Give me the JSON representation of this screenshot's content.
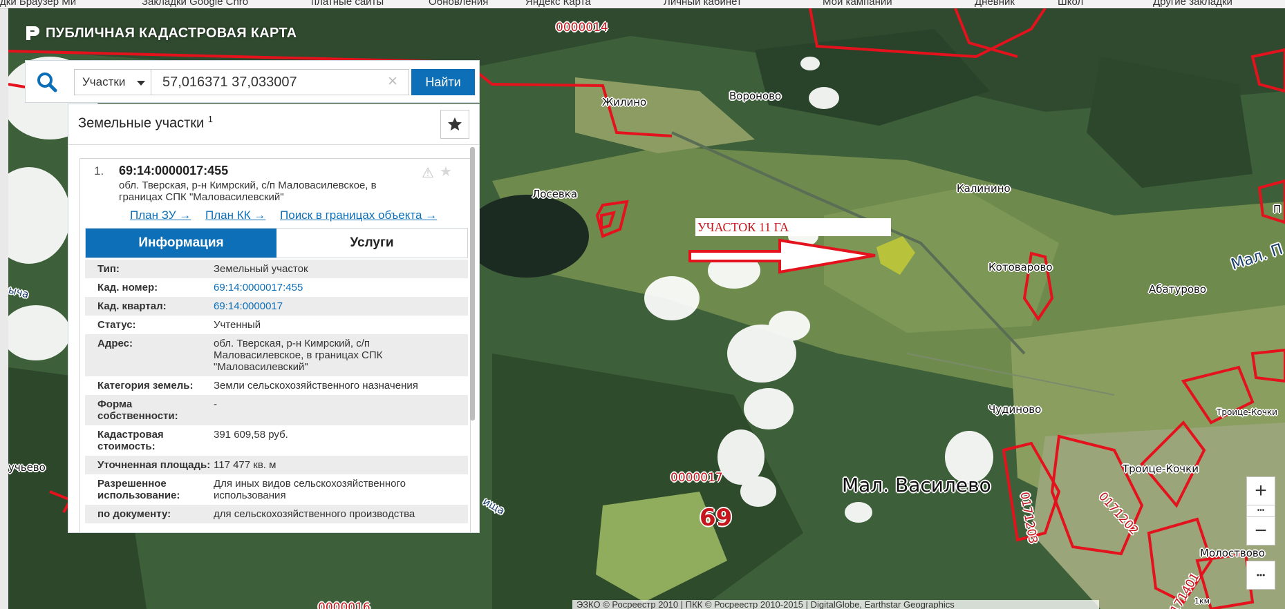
{
  "bookmarks": [
    {
      "label": "дки Браузер Ми"
    },
    {
      "label": "Закладки Google Chro"
    },
    {
      "label": "платные сайты"
    },
    {
      "label": "Обновления"
    },
    {
      "label": "Яндекс Карта"
    },
    {
      "label": "Личный кабинет"
    },
    {
      "label": "Мои кампании"
    },
    {
      "label": "Дневник"
    },
    {
      "label": "Школ"
    },
    {
      "label": "Другие закладки"
    }
  ],
  "header": {
    "title": "ПУБЛИЧНАЯ КАДАСТРОВАЯ КАРТА"
  },
  "search": {
    "type_label": "Участки",
    "query": "57,016371 37,033007",
    "clear_symbol": "×",
    "find_label": "Найти"
  },
  "results_panel": {
    "title": "Земельные участки",
    "count": "1",
    "item": {
      "number": "1.",
      "cad_number": "69:14:0000017:455",
      "address": "обл. Тверская, р-н Кимрский, с/п Маловасилевское, в границах СПК \"Маловасилевский\"",
      "links": [
        "План ЗУ →",
        "План КК →",
        "Поиск в границах объекта →"
      ],
      "tabs": [
        "Информация",
        "Услуги"
      ],
      "attributes": [
        {
          "key": "Тип:",
          "value": "Земельный участок"
        },
        {
          "key": "Кад. номер:",
          "value": "69:14:0000017:455"
        },
        {
          "key": "Кад. квартал:",
          "value": "69:14:0000017"
        },
        {
          "key": "Статус:",
          "value": "Учтенный"
        },
        {
          "key": "Адрес:",
          "value": "обл. Тверская, р-н Кимрский, с/п Маловасилевское, в границах СПК \"Маловасилевский\""
        },
        {
          "key": "Категория земель:",
          "value": "Земли сельскохозяйственного назначения"
        },
        {
          "key": "Форма собственности:",
          "value": "-"
        },
        {
          "key": "Кадастровая стоимость:",
          "value": "391 609,58 руб."
        },
        {
          "key": "Уточненная площадь:",
          "value": "117 477 кв. м"
        },
        {
          "key": "Разрешенное использование:",
          "value": "Для иных видов сельскохозяйственного использования"
        },
        {
          "key": "по документу:",
          "value": "для сельскохозяйственного производства"
        }
      ]
    }
  },
  "map": {
    "annotation": "УЧАСТОК 11 ГА",
    "places": [
      "Жилино",
      "Вороново",
      "Лосевка",
      "Калинино",
      "Котоварово",
      "Абатурово",
      "Чудиново",
      "Мал. Василево",
      "Троице-Кочки",
      "Молоствово",
      "Троице-Кочки",
      "учьево",
      "Мал. П",
      "П",
      "ыча",
      "ища"
    ],
    "quarters": [
      "0000014",
      "0000017",
      "0171203",
      "0171202",
      "0171401",
      "0000016"
    ],
    "region_number": "69",
    "scale": "1км",
    "copyright": "ЭЗКО © Росреестр 2010 | ПКК © Росреестр 2010-2015 | DigitalGlobe, Earthstar Geographics",
    "zoom_in": "+",
    "zoom_out": "−",
    "more_symbol": "•••"
  },
  "colors": {
    "accent": "#0c6fb8",
    "boundary": "#e3121c",
    "parcel": "#b8c23a"
  }
}
